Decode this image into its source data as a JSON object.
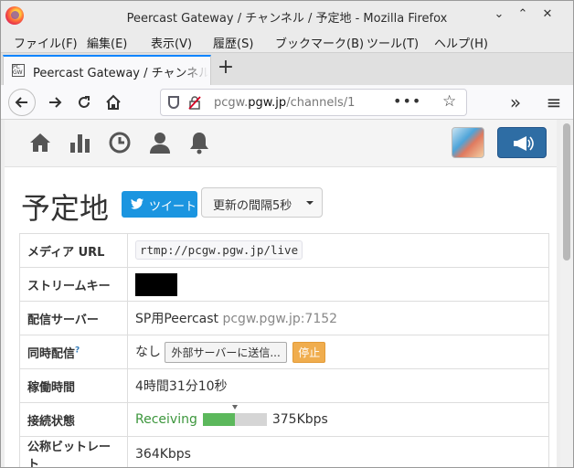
{
  "window": {
    "title": "Peercast Gateway / チャンネル / 予定地 - Mozilla Firefox",
    "controls": [
      "⌄",
      "⌃",
      "✕"
    ]
  },
  "menu": [
    "ファイル(F)",
    "編集(E)",
    "表示(V)",
    "履歴(S)",
    "ブックマーク(B)",
    "ツール(T)",
    "ヘルプ(H)"
  ],
  "tab": {
    "title": "Peercast Gateway / チャンネル / 予定地",
    "favicon": "PC GW"
  },
  "urlbar": {
    "domain_prefix": "pcgw.",
    "domain": "pgw.jp",
    "path": "/channels/1",
    "more": "•••"
  },
  "page": {
    "title": "予定地",
    "tweet_label": "ツイート",
    "interval_label": "更新の間隔5秒",
    "rows": {
      "media_url": {
        "key": "メディア URL",
        "value": "rtmp://pcgw.pgw.jp/live"
      },
      "stream_key": {
        "key": "ストリームキー"
      },
      "server": {
        "key": "配信サーバー",
        "value": "SP用Peercast",
        "host": "pcgw.pgw.jp:7152"
      },
      "simulcast": {
        "key": "同時配信",
        "help": "?",
        "value": "なし",
        "send_button": "外部サーバーに送信...",
        "stop_button": "停止"
      },
      "uptime": {
        "key": "稼働時間",
        "value": "4時間31分10秒"
      },
      "connection": {
        "key": "接続状態",
        "status": "Receiving",
        "bitrate": "375Kbps",
        "level": 0.5
      },
      "nominal": {
        "key": "公称ビットレート",
        "value": "364Kbps"
      }
    }
  },
  "colors": {
    "accent_blue": "#2e6da4",
    "twitter": "#1b95e0",
    "warning": "#f0ad4e",
    "success": "#5cb85c"
  }
}
